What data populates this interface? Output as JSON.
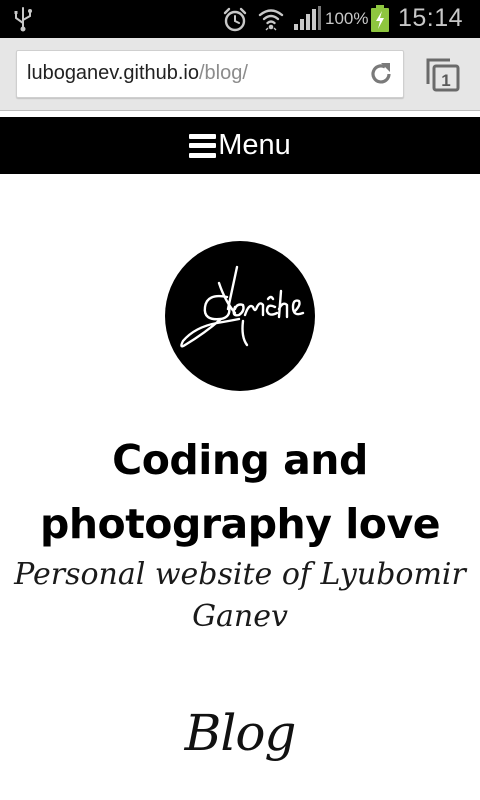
{
  "status_bar": {
    "battery_percent": "100%",
    "time": "15:14",
    "icons": [
      "usb-icon",
      "alarm-icon",
      "wifi-icon",
      "signal-icon",
      "battery-charging-icon"
    ],
    "icon_color": "#c8c8c8"
  },
  "browser": {
    "url_host": "luboganev.github.io",
    "url_path": "/blog/",
    "tab_count": "1",
    "icons": [
      "reload-icon",
      "tabs-icon"
    ]
  },
  "page": {
    "menu_label": "Menu",
    "logo_text": "Ganche",
    "title": "Coding and photography love",
    "subtitle": "Personal website of Lyubomir Ganev",
    "section_heading": "Blog",
    "colors": {
      "menu_background": "#000000",
      "text": "#000000",
      "background": "#ffffff"
    }
  }
}
